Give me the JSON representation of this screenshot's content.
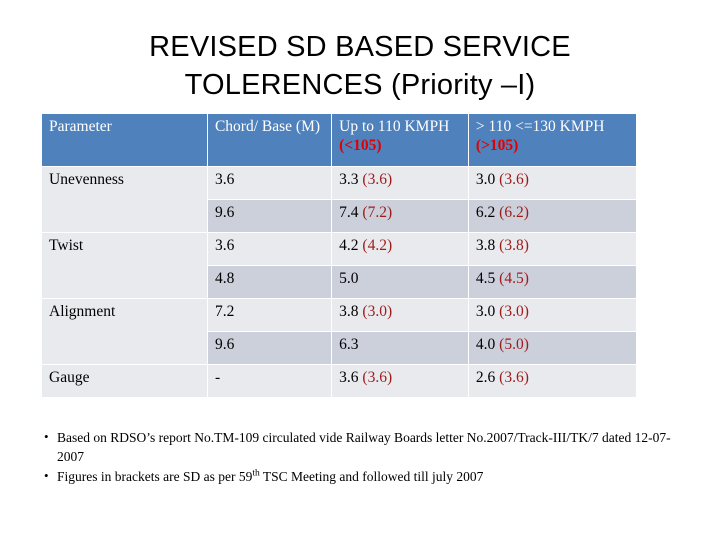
{
  "slide": {
    "title": "REVISED SD BASED SERVICE\nTOLERENCES (Priority –I)"
  },
  "colors": {
    "header_bg": "#4f81bd",
    "header_text": "#ffffff",
    "header_accent_red": "#e00000",
    "body_accent_red": "#9e1b1b",
    "row_light": "#e9eaee",
    "row_dark": "#ccd0db"
  },
  "table": {
    "headers": {
      "parameter": "Parameter",
      "chord_base": "Chord/ Base (M)",
      "up_to_110_main": "Up to 110 KMPH",
      "up_to_110_red": "(<105)",
      "gt110_main": "> 110 <=130 KMPH",
      "gt110_red": "(>105)"
    },
    "rows": [
      {
        "parameter": "Unevenness",
        "chord": "3.6",
        "up110_main": "3.3",
        "up110_red": "(3.6)",
        "gt110_main": "3.0",
        "gt110_red": "(3.6)"
      },
      {
        "parameter": "",
        "chord": "9.6",
        "up110_main": "7.4",
        "up110_red": "(7.2)",
        "gt110_main": "6.2",
        "gt110_red": "(6.2)"
      },
      {
        "parameter": "Twist",
        "chord": "3.6",
        "up110_main": "4.2",
        "up110_red": "(4.2)",
        "gt110_main": "3.8",
        "gt110_red": "(3.8)"
      },
      {
        "parameter": "",
        "chord": "4.8",
        "up110_main": "5.0",
        "up110_red": "",
        "gt110_main": "4.5",
        "gt110_red": "(4.5)"
      },
      {
        "parameter": "Alignment",
        "chord": "7.2",
        "up110_main": "3.8",
        "up110_red": "(3.0)",
        "gt110_main": "3.0",
        "gt110_red": "(3.0)"
      },
      {
        "parameter": "",
        "chord": "9.6",
        "up110_main": "6.3",
        "up110_red": "",
        "gt110_main": "4.0",
        "gt110_red": "(5.0)"
      },
      {
        "parameter": "Gauge",
        "chord": "-",
        "up110_main": "3.6",
        "up110_red": "(3.6)",
        "gt110_main": "2.6",
        "gt110_red": "(3.6)"
      }
    ]
  },
  "footnotes": {
    "bullet": "•",
    "item1": "Based on RDSO’s report No.TM-109 circulated vide Railway Boards letter No.2007/Track-III/TK/7 dated 12-07-2007",
    "item2_pre": "Figures in brackets are SD as per 59",
    "item2_sup": "th",
    "item2_post": " TSC Meeting and followed till july 2007"
  }
}
